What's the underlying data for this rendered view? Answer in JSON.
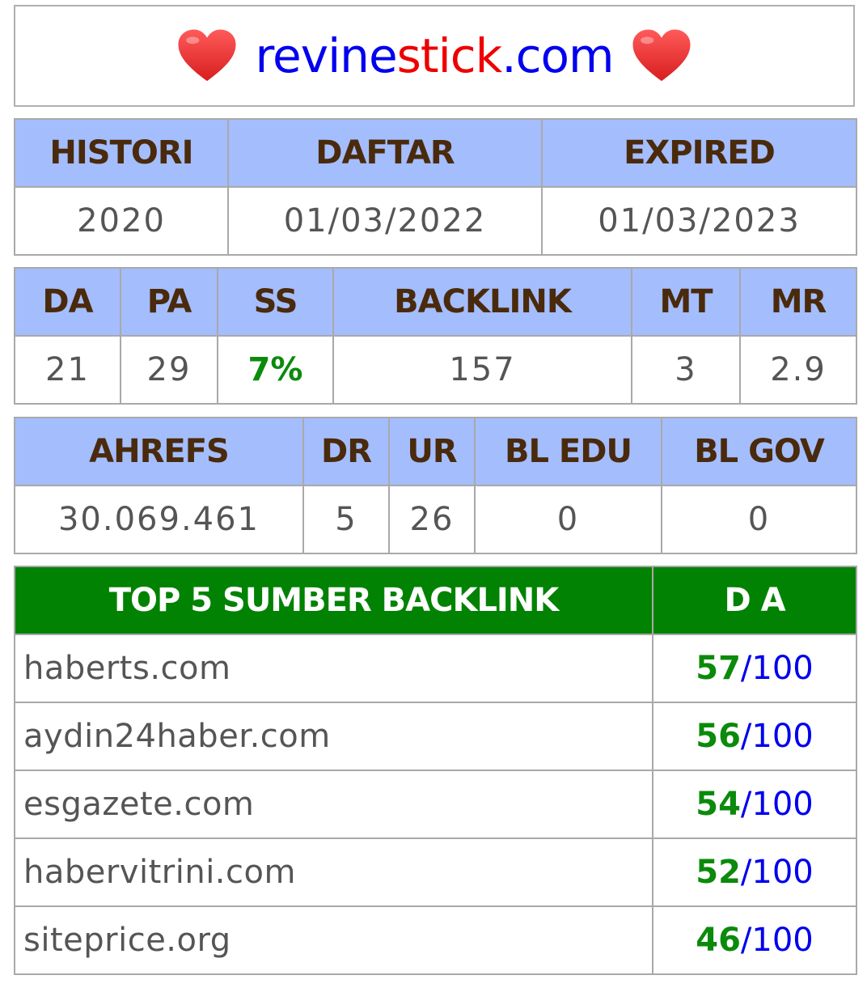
{
  "header": {
    "heart_icon": "heart-icon",
    "domain_part1": "revine",
    "domain_part2": "stick",
    "domain_part3": ".com"
  },
  "registration": {
    "headers": [
      "HISTORI",
      "DAFTAR",
      "EXPIRED"
    ],
    "values": [
      "2020",
      "01/03/2022",
      "01/03/2023"
    ]
  },
  "metrics": {
    "headers": [
      "DA",
      "PA",
      "SS",
      "BACKLINK",
      "MT",
      "MR"
    ],
    "values": [
      "21",
      "29",
      "7%",
      "157",
      "3",
      "2.9"
    ]
  },
  "ahrefs": {
    "headers": [
      "AHREFS",
      "DR",
      "UR",
      "BL EDU",
      "BL GOV"
    ],
    "values": [
      "30.069.461",
      "5",
      "26",
      "0",
      "0"
    ]
  },
  "top_backlinks": {
    "headers": [
      "TOP 5 SUMBER BACKLINK",
      "D A"
    ],
    "rows": [
      {
        "site": "haberts.com",
        "score": "57",
        "total": "/100"
      },
      {
        "site": "aydin24haber.com",
        "score": "56",
        "total": "/100"
      },
      {
        "site": "esgazete.com",
        "score": "54",
        "total": "/100"
      },
      {
        "site": "habervitrini.com",
        "score": "52",
        "total": "/100"
      },
      {
        "site": "siteprice.org",
        "score": "46",
        "total": "/100"
      }
    ]
  },
  "colors": {
    "header_blue": "#a4bdfc",
    "header_green": "#028202",
    "link_blue": "#0000ee",
    "accent_red": "#ee0000",
    "score_green": "#0b8a0b"
  }
}
